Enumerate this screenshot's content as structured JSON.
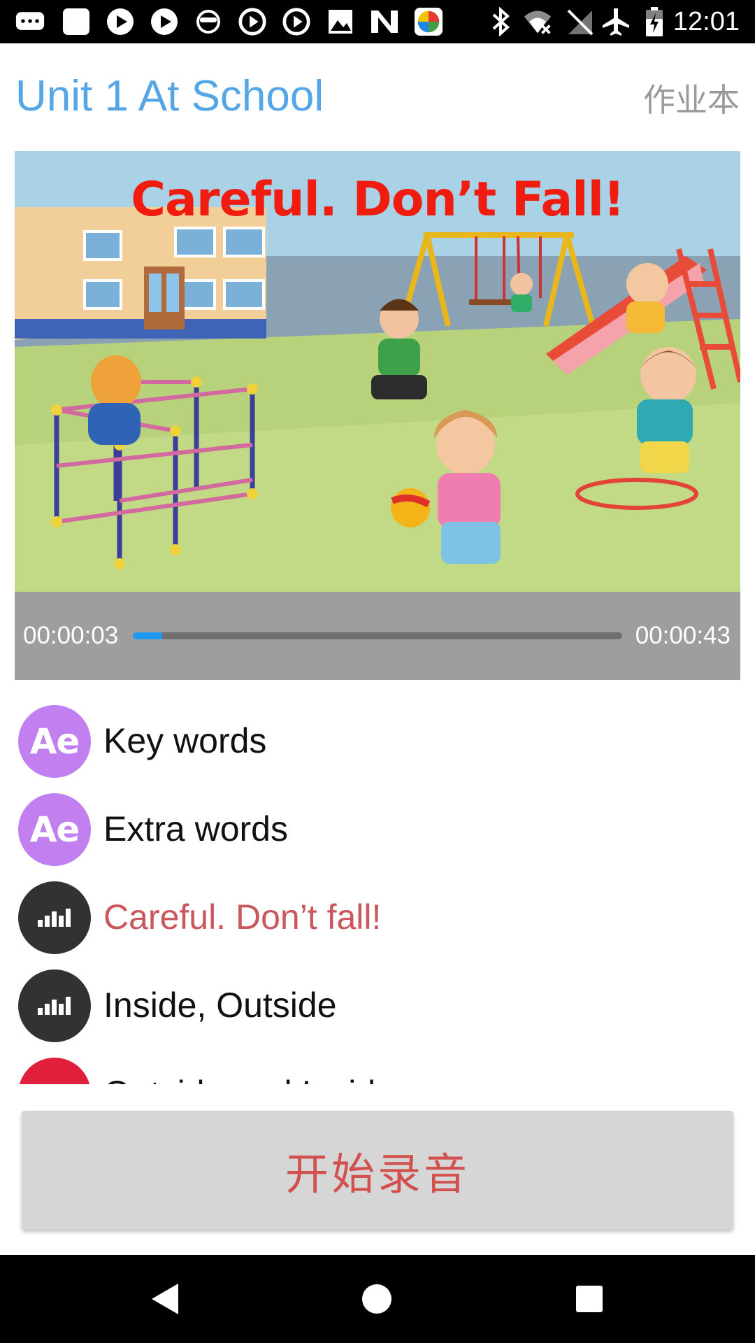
{
  "status_bar": {
    "time": "12:01",
    "left_icons": [
      "chat-icon",
      "app-square-icon",
      "play-icon",
      "play-icon",
      "mask-icon",
      "play-circle-icon",
      "play-circle-icon",
      "image-icon",
      "n-logo-icon",
      "color-ball-icon"
    ],
    "right_icons": [
      "bluetooth-icon",
      "wifi-off-icon",
      "no-signal-icon",
      "airplane-icon",
      "battery-charging-icon"
    ]
  },
  "header": {
    "title": "Unit 1 At School",
    "notebook_label": "作业本"
  },
  "video": {
    "caption": "Careful. Don’t Fall!",
    "current_time": "00:00:03",
    "total_time": "00:00:43",
    "progress": 0.06,
    "accent_color": "#1e9bf0"
  },
  "lessons": [
    {
      "icon": "ae",
      "icon_text": "Ae",
      "label": "Key words",
      "active": false
    },
    {
      "icon": "ae",
      "icon_text": "Ae",
      "label": "Extra words",
      "active": false
    },
    {
      "icon": "audio",
      "icon_text": "",
      "label": "Careful. Don’t fall!",
      "active": true
    },
    {
      "icon": "audio",
      "icon_text": "",
      "label": "Inside, Outside",
      "active": false
    },
    {
      "icon": "book",
      "icon_text": "",
      "label": "Outside and Inside",
      "active": false
    }
  ],
  "record_button": {
    "label": "开始录音"
  },
  "colors": {
    "title_blue": "#55a6e6",
    "active_red": "#c9575c",
    "record_text": "#d2514f"
  }
}
